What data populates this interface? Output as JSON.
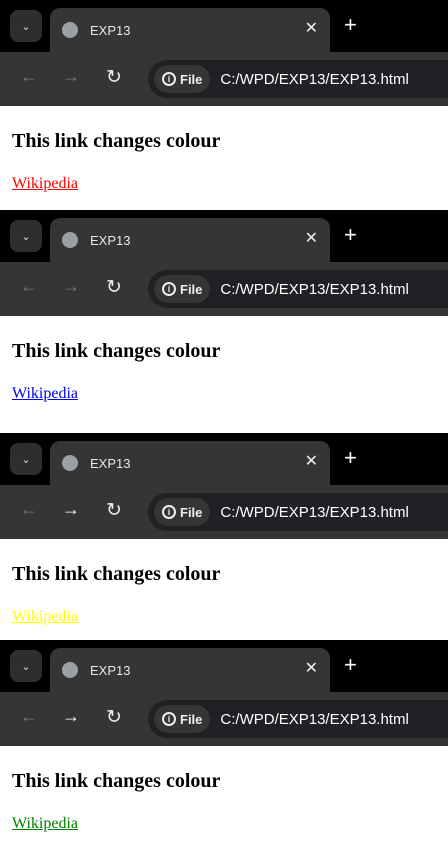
{
  "panels": [
    {
      "tab_title": "EXP13",
      "chip_label": "File",
      "url": "C:/WPD/EXP13/EXP13.html",
      "heading": "This link changes colour",
      "link_text": "Wikipedia",
      "link_color": "#ff0000",
      "forward_enabled": false
    },
    {
      "tab_title": "EXP13",
      "chip_label": "File",
      "url": "C:/WPD/EXP13/EXP13.html",
      "heading": "This link changes colour",
      "link_text": "Wikipedia",
      "link_color": "#0000ee",
      "forward_enabled": false
    },
    {
      "tab_title": "EXP13",
      "chip_label": "File",
      "url": "C:/WPD/EXP13/EXP13.html",
      "heading": "This link changes colour",
      "link_text": "Wikipedia",
      "link_color": "#ffff00",
      "forward_enabled": true
    },
    {
      "tab_title": "EXP13",
      "chip_label": "File",
      "url": "C:/WPD/EXP13/EXP13.html",
      "heading": "This link changes colour",
      "link_text": "Wikipedia",
      "link_color": "#008000",
      "forward_enabled": true
    }
  ],
  "icons": {
    "dropdown": "chevron-down-icon",
    "favicon": "globe-icon",
    "close": "close-icon",
    "new_tab": "plus-icon",
    "back": "arrow-left-icon",
    "forward": "arrow-right-icon",
    "reload": "reload-icon",
    "info": "info-icon"
  }
}
